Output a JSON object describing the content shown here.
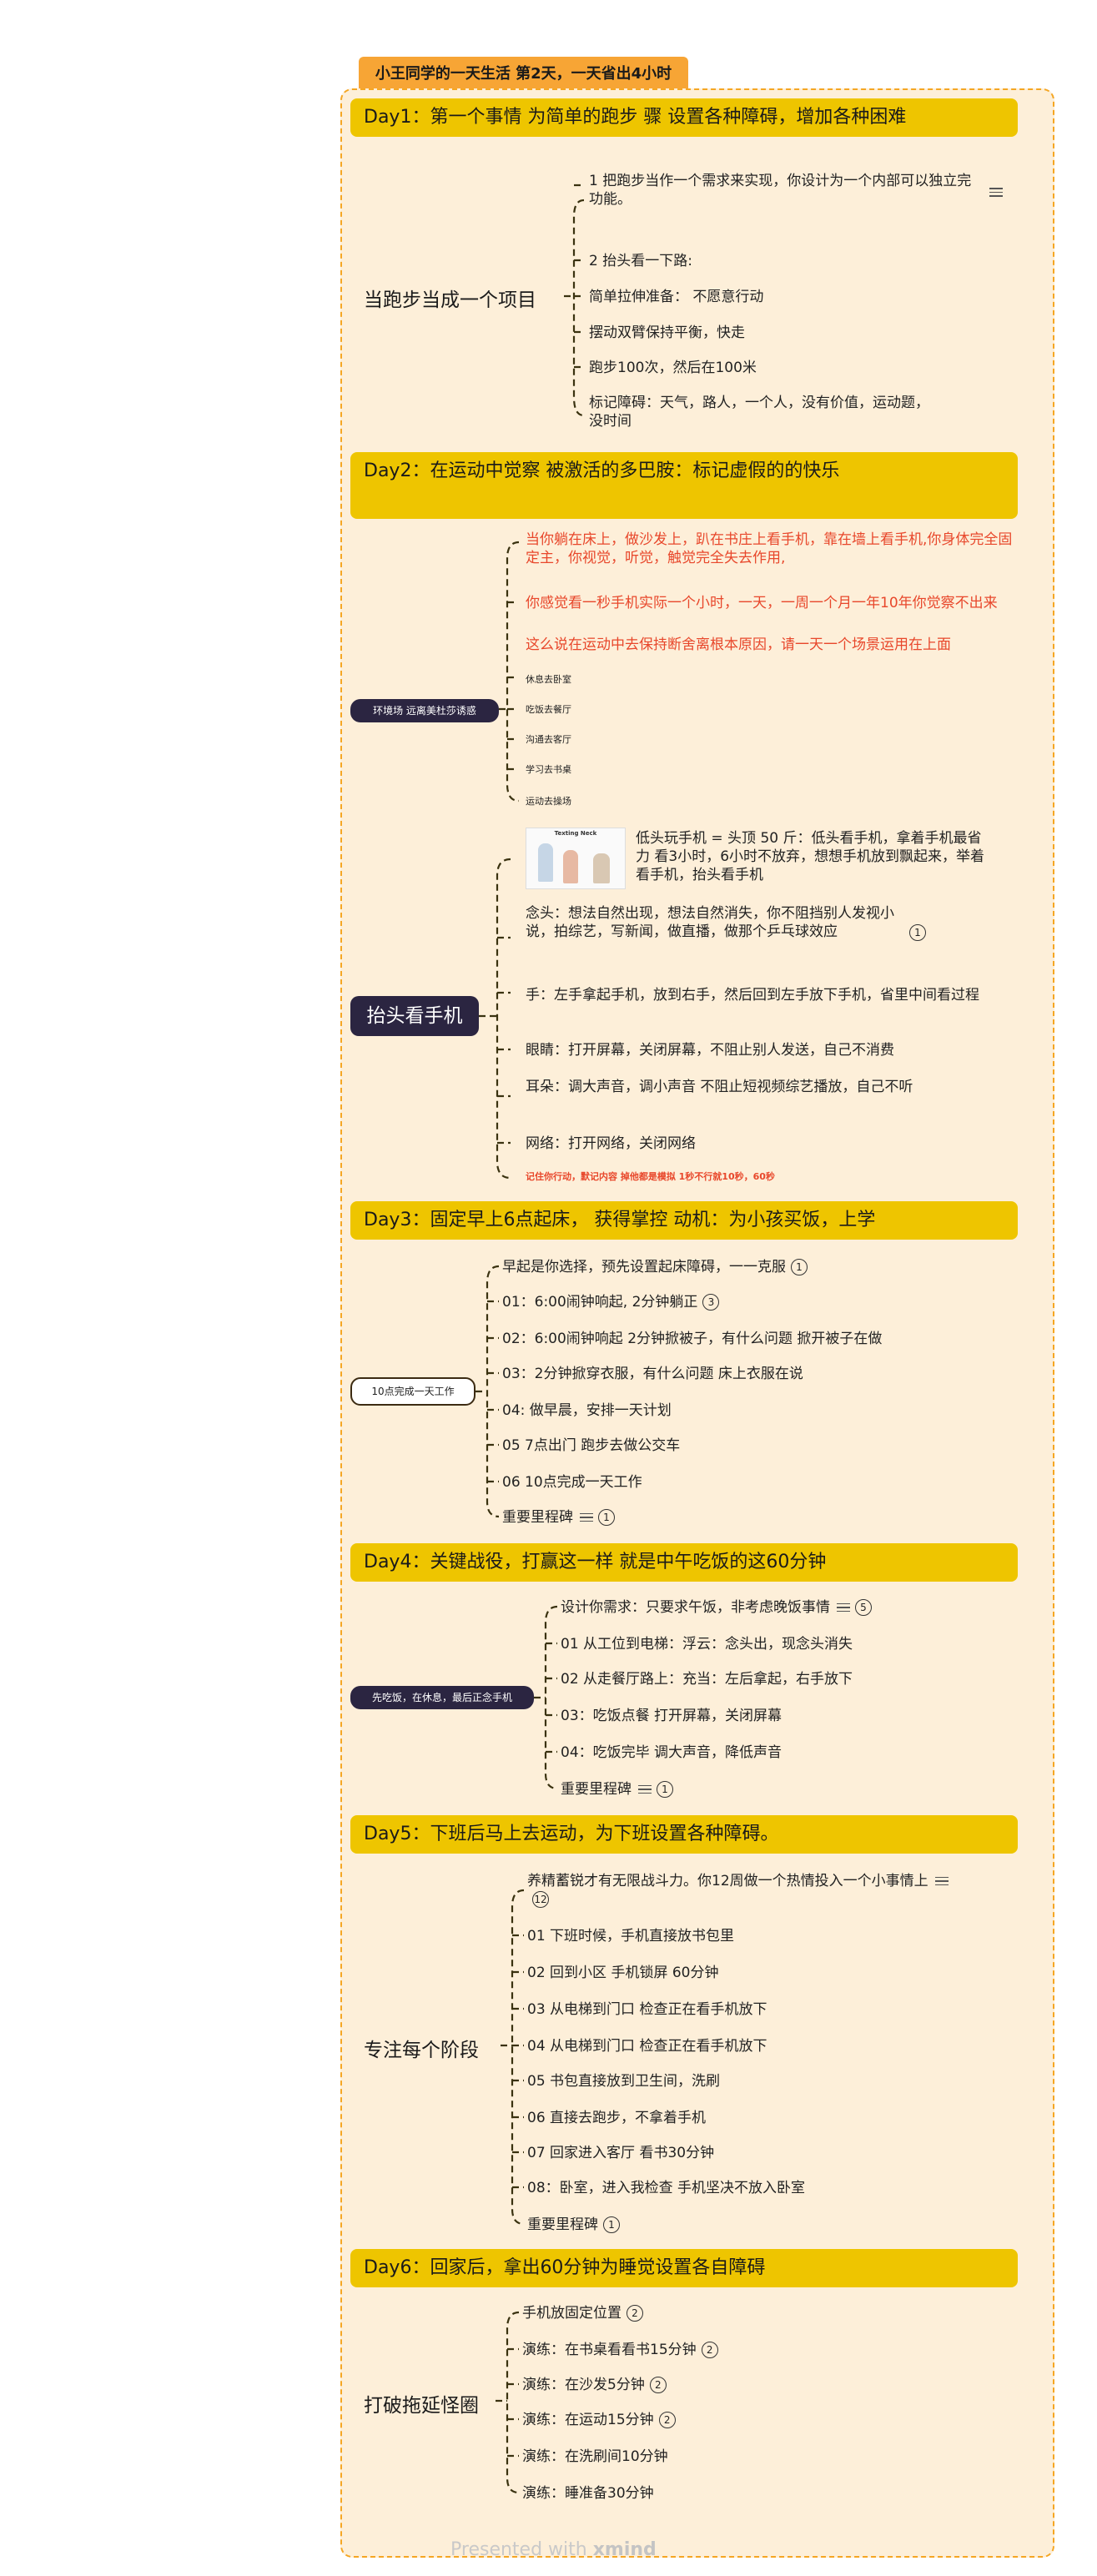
{
  "title": "小王同学的一天生活 第2天，一天省出4小时",
  "footer": {
    "prefix": "Presented with",
    "brand": "xmind"
  },
  "days": [
    {
      "band": "Day1：第一个事情 为简单的跑步 骤 设置各种障碍，增加各种困难",
      "subject": "当跑步当成一个项目",
      "items": [
        "1 把跑步当作一个需求来实现，你设计为一个内部可以独立完功能。",
        "2 抬头看一下路:",
        "简单拉伸准备： 不愿意行动",
        "摆动双臂保持平衡，快走",
        "跑步100次，然后在100米",
        "标记障碍：天气，路人，一个人，没有价值，运动题，没时间"
      ]
    },
    {
      "band": "Day2：在运动中觉察 被激活的多巴胺：标记虚假的的快乐",
      "subject": "环境场 远离美杜莎诱惑",
      "items": [
        "当你躺在床上，做沙发上，趴在书庄上看手机，靠在墙上看手机,你身体完全固定主，你视觉，听觉，触觉完全失去作用,",
        "你感觉看一秒手机实际一个小时，一天，一周一个月一年10年你觉察不出来",
        "这么说在运动中去保持断舍离根本原因，请一天一个场景运用在上面",
        "休息去卧室",
        "吃饭去餐厅",
        "沟通去客厅",
        "学习去书桌",
        "运动去操场"
      ],
      "subject2": "抬头看手机",
      "image_caption": "Texting Neck",
      "items2": [
        "低头玩手机 = 头顶 50 斤：低头看手机，拿着手机最省力 看3小时，6小时不放弃，想想手机放到飘起来，举着看手机，抬头看手机",
        "念头：想法自然出现，想法自然消失，你不阻挡别人发视小说，拍综艺，写新闻，做直播，做那个乒乓球效应",
        "手：左手拿起手机，放到右手，然后回到左手放下手机，省里中间看过程",
        "眼睛：打开屏幕，关闭屏幕，不阻止别人发送，自己不消费",
        "耳朵：调大声音，调小声音 不阻止短视频综艺播放，自己不听",
        "网络：打开网络，关闭网络",
        "记住你行动，默记内容 掉他都是模拟 1秒不行就10秒，60秒"
      ],
      "badge": "1"
    },
    {
      "band": "Day3：固定早上6点起床， 获得掌控 动机：为小孩买饭，上学",
      "subject": "10点完成一天工作",
      "items": [
        "早起是你选择，预先设置起床障碍，一一克服",
        "01：6:00闹钟响起, 2分钟躺正",
        "02：6:00闹钟响起 2分钟掀被子，有什么问题 掀开被子在做",
        "03：2分钟掀穿衣服，有什么问题 床上衣服在说",
        "04: 做早晨，安排一天计划",
        "05 7点出门 跑步去做公交车",
        "06 10点完成一天工作",
        "重要里程碑"
      ],
      "badges": [
        "1",
        "3",
        "",
        "",
        "",
        "",
        "",
        "1"
      ]
    },
    {
      "band": "Day4：关键战役，打赢这一样 就是中午吃饭的这60分钟",
      "subject": "先吃饭，在休息，最后正念手机",
      "items": [
        "设计你需求：只要求午饭，非考虑晚饭事情",
        "01 从工位到电梯：浮云：念头出，现念头消失",
        "02 从走餐厅路上：充当：左后拿起，右手放下",
        "03：吃饭点餐 打开屏幕，关闭屏幕",
        "04：吃饭完毕 调大声音，降低声音",
        "重要里程碑"
      ],
      "badges": [
        "5",
        "",
        "",
        "",
        "",
        "1"
      ]
    },
    {
      "band": "Day5：下班后马上去运动，为下班设置各种障碍。",
      "subject": "专注每个阶段",
      "items": [
        "养精蓄锐才有无限战斗力。你12周做一个热情投入一个小事情上",
        "01 下班时候，手机直接放书包里",
        "02 回到小区 手机锁屏 60分钟",
        "03 从电梯到门口 检查正在看手机放下",
        "04 从电梯到门口 检查正在看手机放下",
        "05 书包直接放到卫生间，洗刷",
        "06 直接去跑步，不拿着手机",
        "07 回家进入客厅 看书30分钟",
        "08：卧室，进入我检查 手机坚决不放入卧室",
        "重要里程碑"
      ],
      "badges": [
        "12",
        "",
        "",
        "",
        "",
        "",
        "",
        "",
        "",
        "1"
      ]
    },
    {
      "band": "Day6：回家后，拿出60分钟为睡觉设置各自障碍",
      "subject": "打破拖延怪圈",
      "items": [
        "手机放固定位置",
        "演练：在书桌看看书15分钟",
        "演练：在沙发5分钟",
        "演练：在运动15分钟",
        "演练：在洗刷间10分钟",
        "演练：睡准备30分钟"
      ],
      "badges": [
        "2",
        "2",
        "2",
        "2",
        "",
        ""
      ]
    }
  ]
}
